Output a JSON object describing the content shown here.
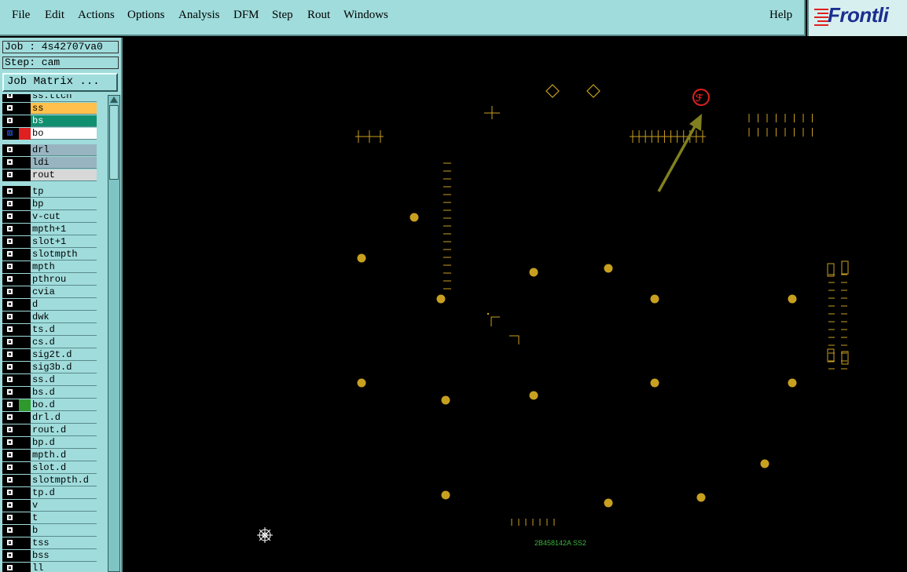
{
  "menu": {
    "items": [
      {
        "label": "File"
      },
      {
        "label": "Edit"
      },
      {
        "label": "Actions"
      },
      {
        "label": "Options"
      },
      {
        "label": "Analysis"
      },
      {
        "label": "DFM"
      },
      {
        "label": "Step"
      },
      {
        "label": "Rout"
      },
      {
        "label": "Windows"
      }
    ],
    "help": "Help"
  },
  "logo": {
    "text": "Frontli"
  },
  "job": {
    "job_label": "Job : 4s42707va0",
    "step_label": "Step: cam",
    "matrix_button": "Job Matrix ..."
  },
  "layers": [
    {
      "name": "ss.ttch",
      "color": "#a0dcdc"
    },
    {
      "name": "ss",
      "color": "#ffc04c"
    },
    {
      "name": "bs",
      "color": "#109070"
    },
    {
      "name": "bo",
      "color": "#ffffff",
      "active": true
    },
    {
      "name": "drl",
      "color": "#98b4c0"
    },
    {
      "name": "ldi",
      "color": "#98b4c0"
    },
    {
      "name": "rout",
      "color": "#d8d8d8"
    },
    {
      "name": "tp",
      "color": "#a0dcdc"
    },
    {
      "name": "bp",
      "color": "#a0dcdc"
    },
    {
      "name": "v-cut",
      "color": "#a0dcdc"
    },
    {
      "name": "mpth+1",
      "color": "#a0dcdc"
    },
    {
      "name": "slot+1",
      "color": "#a0dcdc"
    },
    {
      "name": "slotmpth",
      "color": "#a0dcdc"
    },
    {
      "name": "mpth",
      "color": "#a0dcdc"
    },
    {
      "name": "pthrou",
      "color": "#a0dcdc"
    },
    {
      "name": "cvia",
      "color": "#a0dcdc"
    },
    {
      "name": "d",
      "color": "#a0dcdc"
    },
    {
      "name": "dwk",
      "color": "#a0dcdc"
    },
    {
      "name": "ts.d",
      "color": "#a0dcdc"
    },
    {
      "name": "cs.d",
      "color": "#a0dcdc"
    },
    {
      "name": "sig2t.d",
      "color": "#a0dcdc"
    },
    {
      "name": "sig3b.d",
      "color": "#a0dcdc"
    },
    {
      "name": "ss.d",
      "color": "#a0dcdc"
    },
    {
      "name": "bs.d",
      "color": "#a0dcdc"
    },
    {
      "name": "bo.d",
      "color": "#a0dcdc",
      "indicator": "#2e9a2e"
    },
    {
      "name": "drl.d",
      "color": "#a0dcdc"
    },
    {
      "name": "rout.d",
      "color": "#a0dcdc"
    },
    {
      "name": "bp.d",
      "color": "#a0dcdc"
    },
    {
      "name": "mpth.d",
      "color": "#a0dcdc"
    },
    {
      "name": "slot.d",
      "color": "#a0dcdc"
    },
    {
      "name": "slotmpth.d",
      "color": "#a0dcdc"
    },
    {
      "name": "tp.d",
      "color": "#a0dcdc"
    },
    {
      "name": "v",
      "color": "#a0dcdc"
    },
    {
      "name": "t",
      "color": "#a0dcdc"
    },
    {
      "name": "b",
      "color": "#a0dcdc"
    },
    {
      "name": "tss",
      "color": "#a0dcdc"
    },
    {
      "name": "bss",
      "color": "#a0dcdc"
    },
    {
      "name": "ll",
      "color": "#a0dcdc"
    }
  ],
  "canvas": {
    "feature_color": "#c8a020",
    "marker_color": "#e02020",
    "arrow_color": "#808020",
    "label_color": "#3cb43c",
    "label_text": "2B458142A SS2"
  }
}
